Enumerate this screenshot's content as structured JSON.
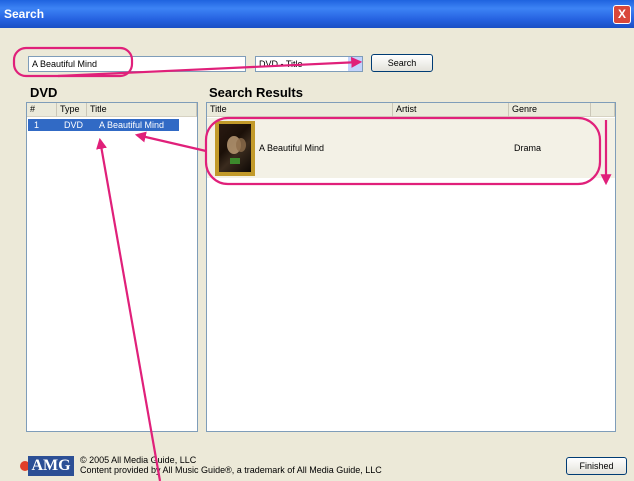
{
  "window": {
    "title": "Search",
    "close_label": "X"
  },
  "search": {
    "value": "A Beautiful Mind",
    "type_selected": "DVD - Title",
    "button_label": "Search"
  },
  "dvd_section": {
    "heading": "DVD",
    "columns": [
      "#",
      "Type",
      "Title"
    ],
    "rows": [
      {
        "num": "1",
        "type": "DVD",
        "title": "A Beautiful Mind"
      }
    ]
  },
  "results_section": {
    "heading": "Search Results",
    "columns": [
      "Title",
      "Artist",
      "Genre"
    ],
    "rows": [
      {
        "title": "A Beautiful Mind",
        "artist": "",
        "genre": "Drama"
      }
    ]
  },
  "footer": {
    "logo_text": "AMG",
    "copyright": "© 2005 All Media Guide, LLC",
    "provided_by": "Content provided by All Music Guide®, a trademark of All Media Guide, LLC",
    "finished_label": "Finished"
  },
  "colors": {
    "annotation": "#e0207a",
    "titlebar": "#2561e0",
    "selection": "#316ac5"
  }
}
